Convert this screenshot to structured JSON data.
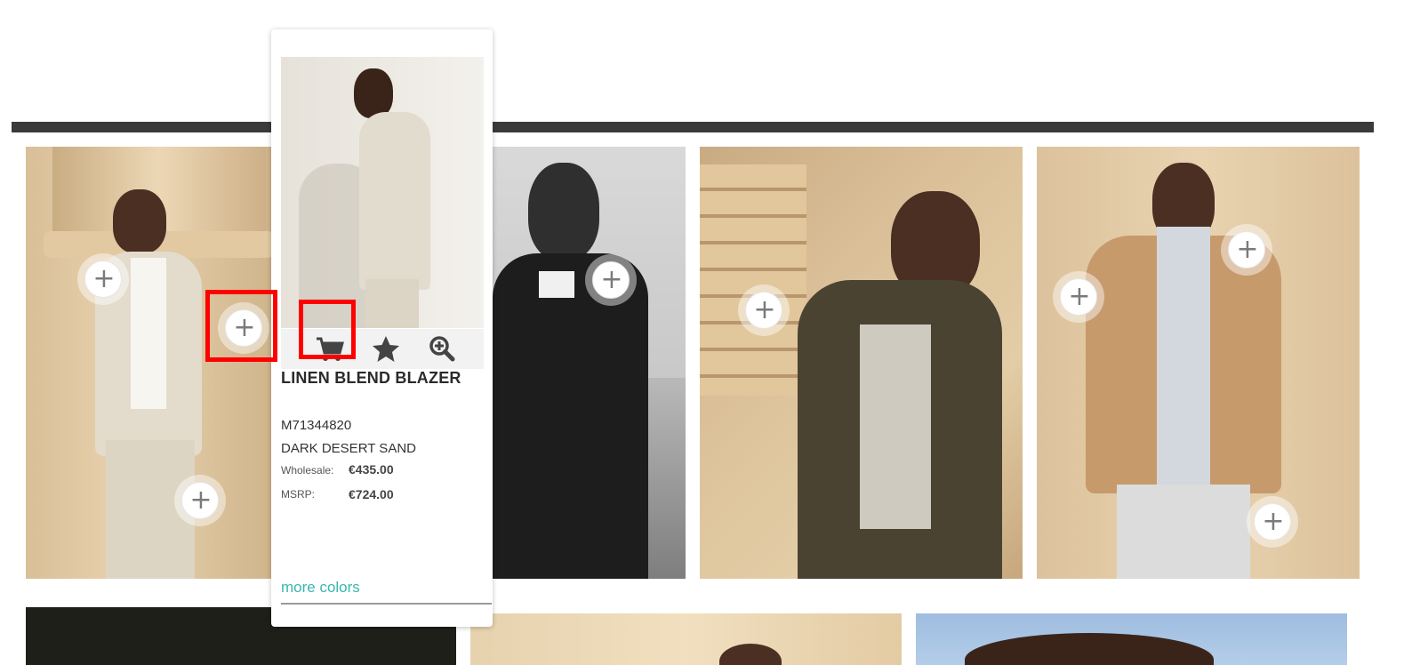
{
  "product_card": {
    "name": "LINEN BLEND BLAZER",
    "sku": "M71344820",
    "color": "DARK DESERT SAND",
    "wholesale_label": "Wholesale:",
    "wholesale_price": "€435.00",
    "msrp_label": "MSRP:",
    "msrp_price": "€724.00",
    "more_colors": "more colors",
    "actions": [
      "cart-icon",
      "star-icon",
      "zoom-in-icon"
    ]
  },
  "hotspot_symbol": "+",
  "icons": {
    "hotspot": "plus-circle-icon",
    "cart": "cart-icon",
    "favorite": "star-icon",
    "zoom": "zoom-in-icon"
  },
  "colors": {
    "header_bar": "#3a3a3a",
    "link": "#39b8b0",
    "highlight": "#ff0000"
  }
}
